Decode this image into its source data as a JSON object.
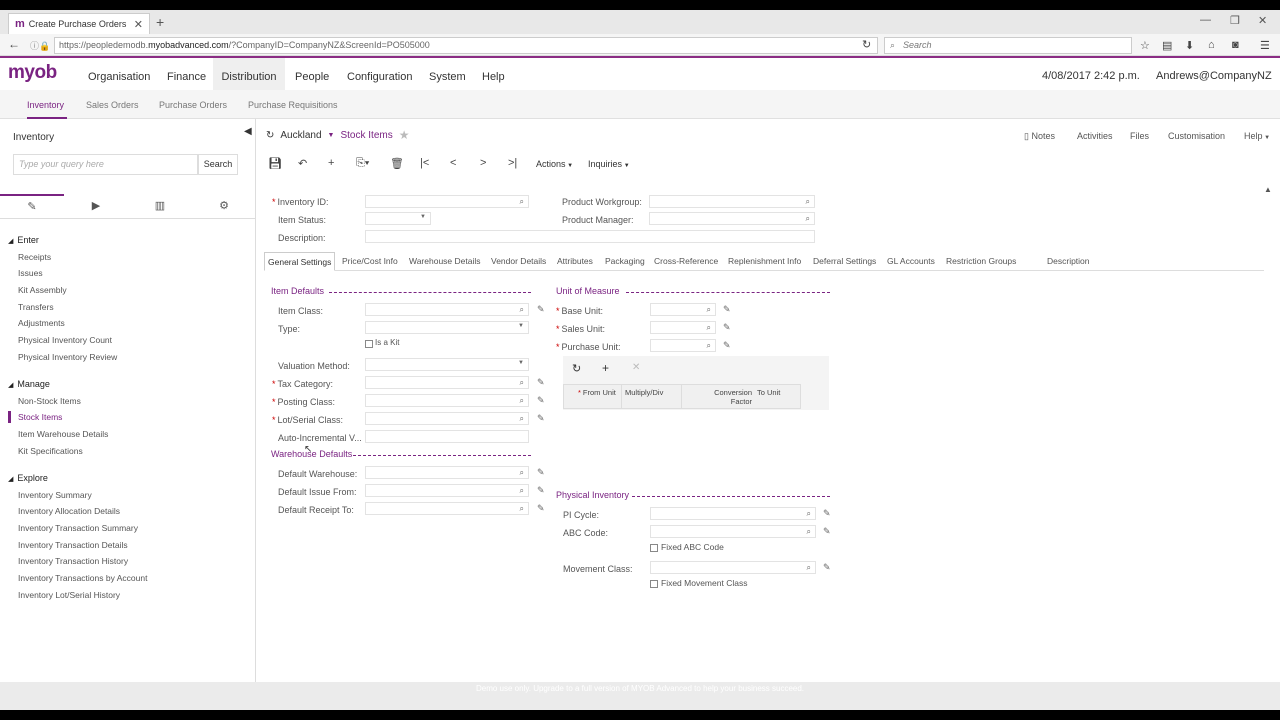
{
  "browser": {
    "tab_title": "Create Purchase Orders",
    "url_prefix": "https://peopledemodb.",
    "url_domain": "myobadvanced.com",
    "url_suffix": "/?CompanyID=CompanyNZ&ScreenId=PO505000",
    "search_placeholder": "Search"
  },
  "app": {
    "logo": "myob",
    "nav": [
      "Organisation",
      "Finance",
      "Distribution",
      "People",
      "Configuration",
      "System",
      "Help"
    ],
    "active_nav": "Distribution",
    "datetime": "4/08/2017  2:42 p.m.",
    "user": "Andrews@CompanyNZ"
  },
  "subnav": [
    "Inventory",
    "Sales Orders",
    "Purchase Orders",
    "Purchase Requisitions"
  ],
  "sidebar": {
    "title": "Inventory",
    "search_placeholder": "Type your query here",
    "search_button": "Search",
    "groups": [
      {
        "label": "Enter",
        "items": [
          "Receipts",
          "Issues",
          "Kit Assembly",
          "Transfers",
          "Adjustments",
          "Physical Inventory Count",
          "Physical Inventory Review"
        ]
      },
      {
        "label": "Manage",
        "items": [
          "Non-Stock Items",
          "Stock Items",
          "Item Warehouse Details",
          "Kit Specifications"
        ]
      },
      {
        "label": "Explore",
        "items": [
          "Inventory Summary",
          "Inventory Allocation Details",
          "Inventory Transaction Summary",
          "Inventory Transaction Details",
          "Inventory Transaction History",
          "Inventory Transactions by Account",
          "Inventory Lot/Serial History"
        ]
      }
    ],
    "active_item": "Stock Items"
  },
  "screen": {
    "breadcrumb_company": "Auckland",
    "breadcrumb_screen": "Stock Items",
    "header_links": [
      "Notes",
      "Activities",
      "Files",
      "Customisation",
      "Help"
    ],
    "toolbar_menus": [
      "Actions",
      "Inquiries"
    ],
    "header_fields": {
      "inventory_id": "Inventory ID:",
      "item_status": "Item Status:",
      "description": "Description:",
      "product_workgroup": "Product Workgroup:",
      "product_manager": "Product Manager:"
    },
    "tabs": [
      "General Settings",
      "Price/Cost Info",
      "Warehouse Details",
      "Vendor Details",
      "Attributes",
      "Packaging",
      "Cross-Reference",
      "Replenishment Info",
      "Deferral Settings",
      "GL Accounts",
      "Restriction Groups",
      "Description"
    ],
    "active_tab": "General Settings",
    "item_defaults": {
      "title": "Item Defaults",
      "item_class": "Item Class:",
      "type": "Type:",
      "is_a_kit": "Is a Kit",
      "valuation_method": "Valuation Method:",
      "tax_category": "Tax Category:",
      "posting_class": "Posting Class:",
      "lot_serial_class": "Lot/Serial Class:",
      "auto_incremental": "Auto-Incremental V..."
    },
    "warehouse_defaults": {
      "title": "Warehouse Defaults",
      "default_warehouse": "Default Warehouse:",
      "default_issue_from": "Default Issue From:",
      "default_receipt_to": "Default Receipt To:"
    },
    "unit_of_measure": {
      "title": "Unit of Measure",
      "base_unit": "Base Unit:",
      "sales_unit": "Sales Unit:",
      "purchase_unit": "Purchase Unit:",
      "grid_headers": [
        "From Unit",
        "Multiply/Div",
        "Conversion Factor",
        "To Unit"
      ]
    },
    "physical_inventory": {
      "title": "Physical Inventory",
      "pi_cycle": "PI Cycle:",
      "abc_code": "ABC Code:",
      "fixed_abc_code": "Fixed ABC Code",
      "movement_class": "Movement Class:",
      "fixed_movement_class": "Fixed Movement Class"
    }
  },
  "footer": "Demo use only. Upgrade to a full version of MYOB Advanced to help your business succeed.",
  "colors": {
    "accent": "#7a2382",
    "required": "#cc0000"
  }
}
